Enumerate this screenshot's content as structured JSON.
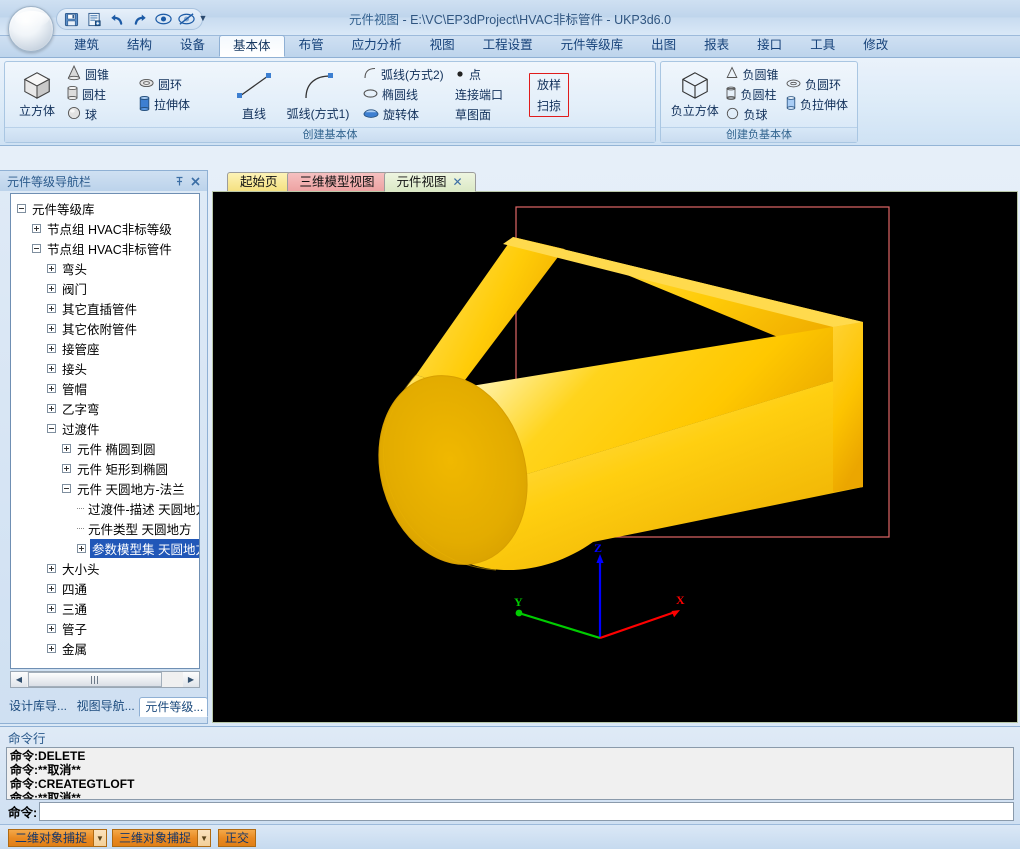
{
  "window": {
    "title_doc": "元件视图",
    "title_path": " - E:\\VC\\EP3dProject\\HVAC非标管件 - UKP3d6.0"
  },
  "quick_access": {
    "buttons": [
      {
        "name": "save-icon",
        "tip": "保存"
      },
      {
        "name": "save-as-icon",
        "tip": "另存为"
      },
      {
        "name": "undo-icon",
        "tip": "撤销"
      },
      {
        "name": "redo-icon",
        "tip": "重做"
      },
      {
        "name": "show-icon",
        "tip": "显示"
      },
      {
        "name": "hide-icon",
        "tip": "隐藏"
      }
    ],
    "more_label": "▼"
  },
  "menu_tabs": [
    {
      "label": "建筑",
      "active": false
    },
    {
      "label": "结构",
      "active": false
    },
    {
      "label": "设备",
      "active": false
    },
    {
      "label": "基本体",
      "active": true
    },
    {
      "label": "布管",
      "active": false
    },
    {
      "label": "应力分析",
      "active": false
    },
    {
      "label": "视图",
      "active": false
    },
    {
      "label": "工程设置",
      "active": false
    },
    {
      "label": "元件等级库",
      "active": false
    },
    {
      "label": "出图",
      "active": false
    },
    {
      "label": "报表",
      "active": false
    },
    {
      "label": "接口",
      "active": false
    },
    {
      "label": "工具",
      "active": false
    },
    {
      "label": "修改",
      "active": false
    }
  ],
  "ribbon": {
    "group_primitives": {
      "title": "创建基本体",
      "cube_label": "立方体",
      "col1": [
        {
          "label": "圆锥",
          "icon": "cone-icon"
        },
        {
          "label": "圆柱",
          "icon": "cylinder-icon"
        },
        {
          "label": "球",
          "icon": "sphere-icon"
        }
      ],
      "col2": [
        {
          "label": "圆环",
          "icon": "torus-icon"
        },
        {
          "label": "拉伸体",
          "icon": "extrude-icon"
        }
      ],
      "line_label": "直线",
      "arc1_label": "弧线(方式1)",
      "col3": [
        {
          "label": "弧线(方式2)",
          "icon": "arc-icon"
        },
        {
          "label": "椭圆线",
          "icon": "ellipse-icon"
        },
        {
          "label": "旋转体",
          "icon": "revolve-icon"
        }
      ],
      "col4": [
        {
          "label": "点",
          "icon": "point-icon"
        },
        {
          "label": "连接端口",
          "icon": "port-icon"
        },
        {
          "label": "草图面",
          "icon": "sketch-plane-icon"
        }
      ],
      "highlighted": [
        {
          "label": "放样"
        },
        {
          "label": "扫掠"
        }
      ]
    },
    "group_negative": {
      "title": "创建负基本体",
      "cube_label": "负立方体",
      "col1": [
        {
          "label": "负圆锥",
          "icon": "neg-cone-icon"
        },
        {
          "label": "负圆柱",
          "icon": "neg-cylinder-icon"
        },
        {
          "label": "负球",
          "icon": "neg-sphere-icon"
        }
      ],
      "col2": [
        {
          "label": "负圆环",
          "icon": "neg-torus-icon"
        },
        {
          "label": "负拉伸体",
          "icon": "neg-extrude-icon"
        }
      ]
    }
  },
  "left_dock": {
    "title": "元件等级导航栏",
    "pin_icon": "pin-icon",
    "close_icon": "close-icon",
    "tree": [
      {
        "label": "元件等级库",
        "indent": 0,
        "state": "minus",
        "selected": false
      },
      {
        "label": "节点组 HVAC非标等级",
        "indent": 1,
        "state": "plus",
        "selected": false
      },
      {
        "label": "节点组 HVAC非标管件",
        "indent": 1,
        "state": "minus",
        "selected": false
      },
      {
        "label": "弯头",
        "indent": 2,
        "state": "plus",
        "selected": false
      },
      {
        "label": "阀门",
        "indent": 2,
        "state": "plus",
        "selected": false
      },
      {
        "label": "其它直插管件",
        "indent": 2,
        "state": "plus",
        "selected": false
      },
      {
        "label": "其它依附管件",
        "indent": 2,
        "state": "plus",
        "selected": false
      },
      {
        "label": "接管座",
        "indent": 2,
        "state": "plus",
        "selected": false
      },
      {
        "label": "接头",
        "indent": 2,
        "state": "plus",
        "selected": false
      },
      {
        "label": "管帽",
        "indent": 2,
        "state": "plus",
        "selected": false
      },
      {
        "label": "乙字弯",
        "indent": 2,
        "state": "plus",
        "selected": false
      },
      {
        "label": "过渡件",
        "indent": 2,
        "state": "minus",
        "selected": false
      },
      {
        "label": "元件 椭圆到圆",
        "indent": 3,
        "state": "plus",
        "selected": false
      },
      {
        "label": "元件 矩形到椭圆",
        "indent": 3,
        "state": "plus",
        "selected": false
      },
      {
        "label": "元件 天圆地方-法兰",
        "indent": 3,
        "state": "minus",
        "selected": false
      },
      {
        "label": "过渡件-描述 天圆地方",
        "indent": 4,
        "state": "leaf",
        "selected": false
      },
      {
        "label": "元件类型 天圆地方",
        "indent": 4,
        "state": "leaf",
        "selected": false
      },
      {
        "label": "参数模型集 天圆地方",
        "indent": 4,
        "state": "plus",
        "selected": true
      },
      {
        "label": "大小头",
        "indent": 2,
        "state": "plus",
        "selected": false
      },
      {
        "label": "四通",
        "indent": 2,
        "state": "plus",
        "selected": false
      },
      {
        "label": "三通",
        "indent": 2,
        "state": "plus",
        "selected": false
      },
      {
        "label": "管子",
        "indent": 2,
        "state": "plus",
        "selected": false
      },
      {
        "label": "金属",
        "indent": 2,
        "state": "plus",
        "selected": false
      }
    ],
    "scroll": {
      "left_arrow": "◀",
      "right_arrow": "▶"
    },
    "panel_tabs": [
      {
        "label": "设计库导...",
        "active": false
      },
      {
        "label": "视图导航...",
        "active": false
      },
      {
        "label": "元件等级...",
        "active": true
      }
    ]
  },
  "view_tabs": [
    {
      "label": "起始页",
      "active": false,
      "closable": false,
      "color": "#f4e07e"
    },
    {
      "label": "三维模型视图",
      "active": false,
      "closable": false,
      "color": "#eda1a1"
    },
    {
      "label": "元件视图",
      "active": true,
      "closable": true,
      "color": "#dbe9c6"
    }
  ],
  "viewport": {
    "background": "#000000",
    "selection_border_color": "#e06666",
    "model_name": "天圆地方过渡件",
    "model_color": "#ffcc00",
    "axes": [
      {
        "label": "Z",
        "color": "#0000ff"
      },
      {
        "label": "Y",
        "color": "#00cc00"
      },
      {
        "label": "X",
        "color": "#ff0000"
      }
    ]
  },
  "command_line": {
    "title": "命令行",
    "history": [
      "命令:DELETE",
      "命令:**取消**",
      "命令:CREATEGTLOFT",
      "命令:**取消**"
    ],
    "prompt": "命令:",
    "input_value": "",
    "input_placeholder": ""
  },
  "status_bar": {
    "buttons": [
      {
        "label": "二维对象捕捉",
        "has_dropdown": true,
        "active": true
      },
      {
        "label": "三维对象捕捉",
        "has_dropdown": true,
        "active": true
      },
      {
        "label": "正交",
        "has_dropdown": false,
        "active": true
      }
    ],
    "dropdown_glyph": "▼",
    "active_color": "#e98a23"
  }
}
